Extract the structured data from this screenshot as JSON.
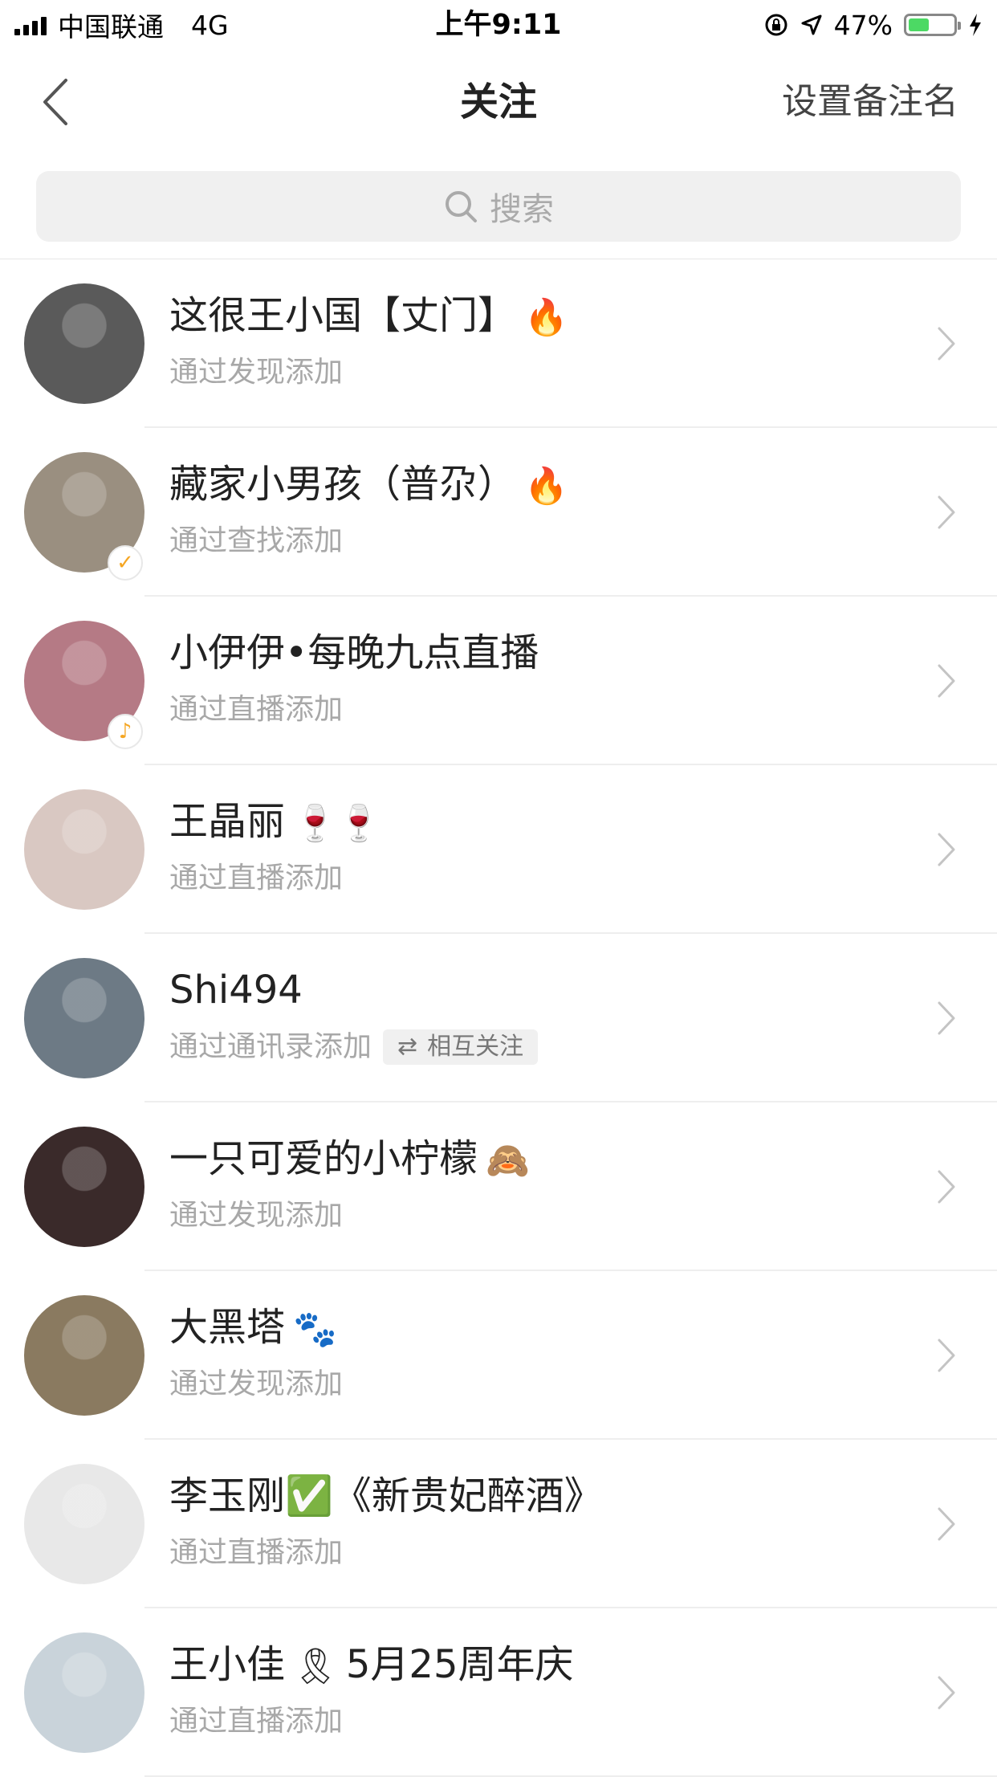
{
  "status_bar": {
    "carrier": "中国联通",
    "network": "4G",
    "time": "上午9:11",
    "battery_text": "47%",
    "battery_level": 0.47
  },
  "nav": {
    "title": "关注",
    "right_action": "设置备注名"
  },
  "search": {
    "placeholder": "搜索"
  },
  "contacts": [
    {
      "name": "这很王小国【丈门】",
      "emoji": "🔥",
      "source": "通过发现添加",
      "avatar_color": "#5a5a5a"
    },
    {
      "name": "藏家小男孩（普尕）",
      "emoji": "🔥",
      "source": "通过查找添加",
      "avatar_color": "#9a8f80",
      "badge": "✓"
    },
    {
      "name": "小伊伊•每晚九点直播",
      "emoji": "",
      "source": "通过直播添加",
      "avatar_color": "#b57a85",
      "badge": "♪"
    },
    {
      "name": "王晶丽",
      "emoji": "🍷🍷",
      "source": "通过直播添加",
      "avatar_color": "#d9c8c2"
    },
    {
      "name": "Shi494",
      "emoji": "",
      "source": "通过通讯录添加",
      "avatar_color": "#6d7a85",
      "mutual": "相互关注"
    },
    {
      "name": "一只可爱的小柠檬",
      "emoji": "🙈",
      "source": "通过发现添加",
      "avatar_color": "#3a2a2a"
    },
    {
      "name": "大黑塔",
      "emoji": "🐾",
      "source": "通过发现添加",
      "avatar_color": "#8a7a60"
    },
    {
      "name": "李玉刚✅《新贵妃醉酒》",
      "emoji": "",
      "source": "通过直播添加",
      "avatar_color": "#e8e8e8"
    },
    {
      "name": "王小佳",
      "emoji": "🎗",
      "name_suffix": "5月25周年庆",
      "source": "通过直播添加",
      "avatar_color": "#c9d3da"
    }
  ]
}
